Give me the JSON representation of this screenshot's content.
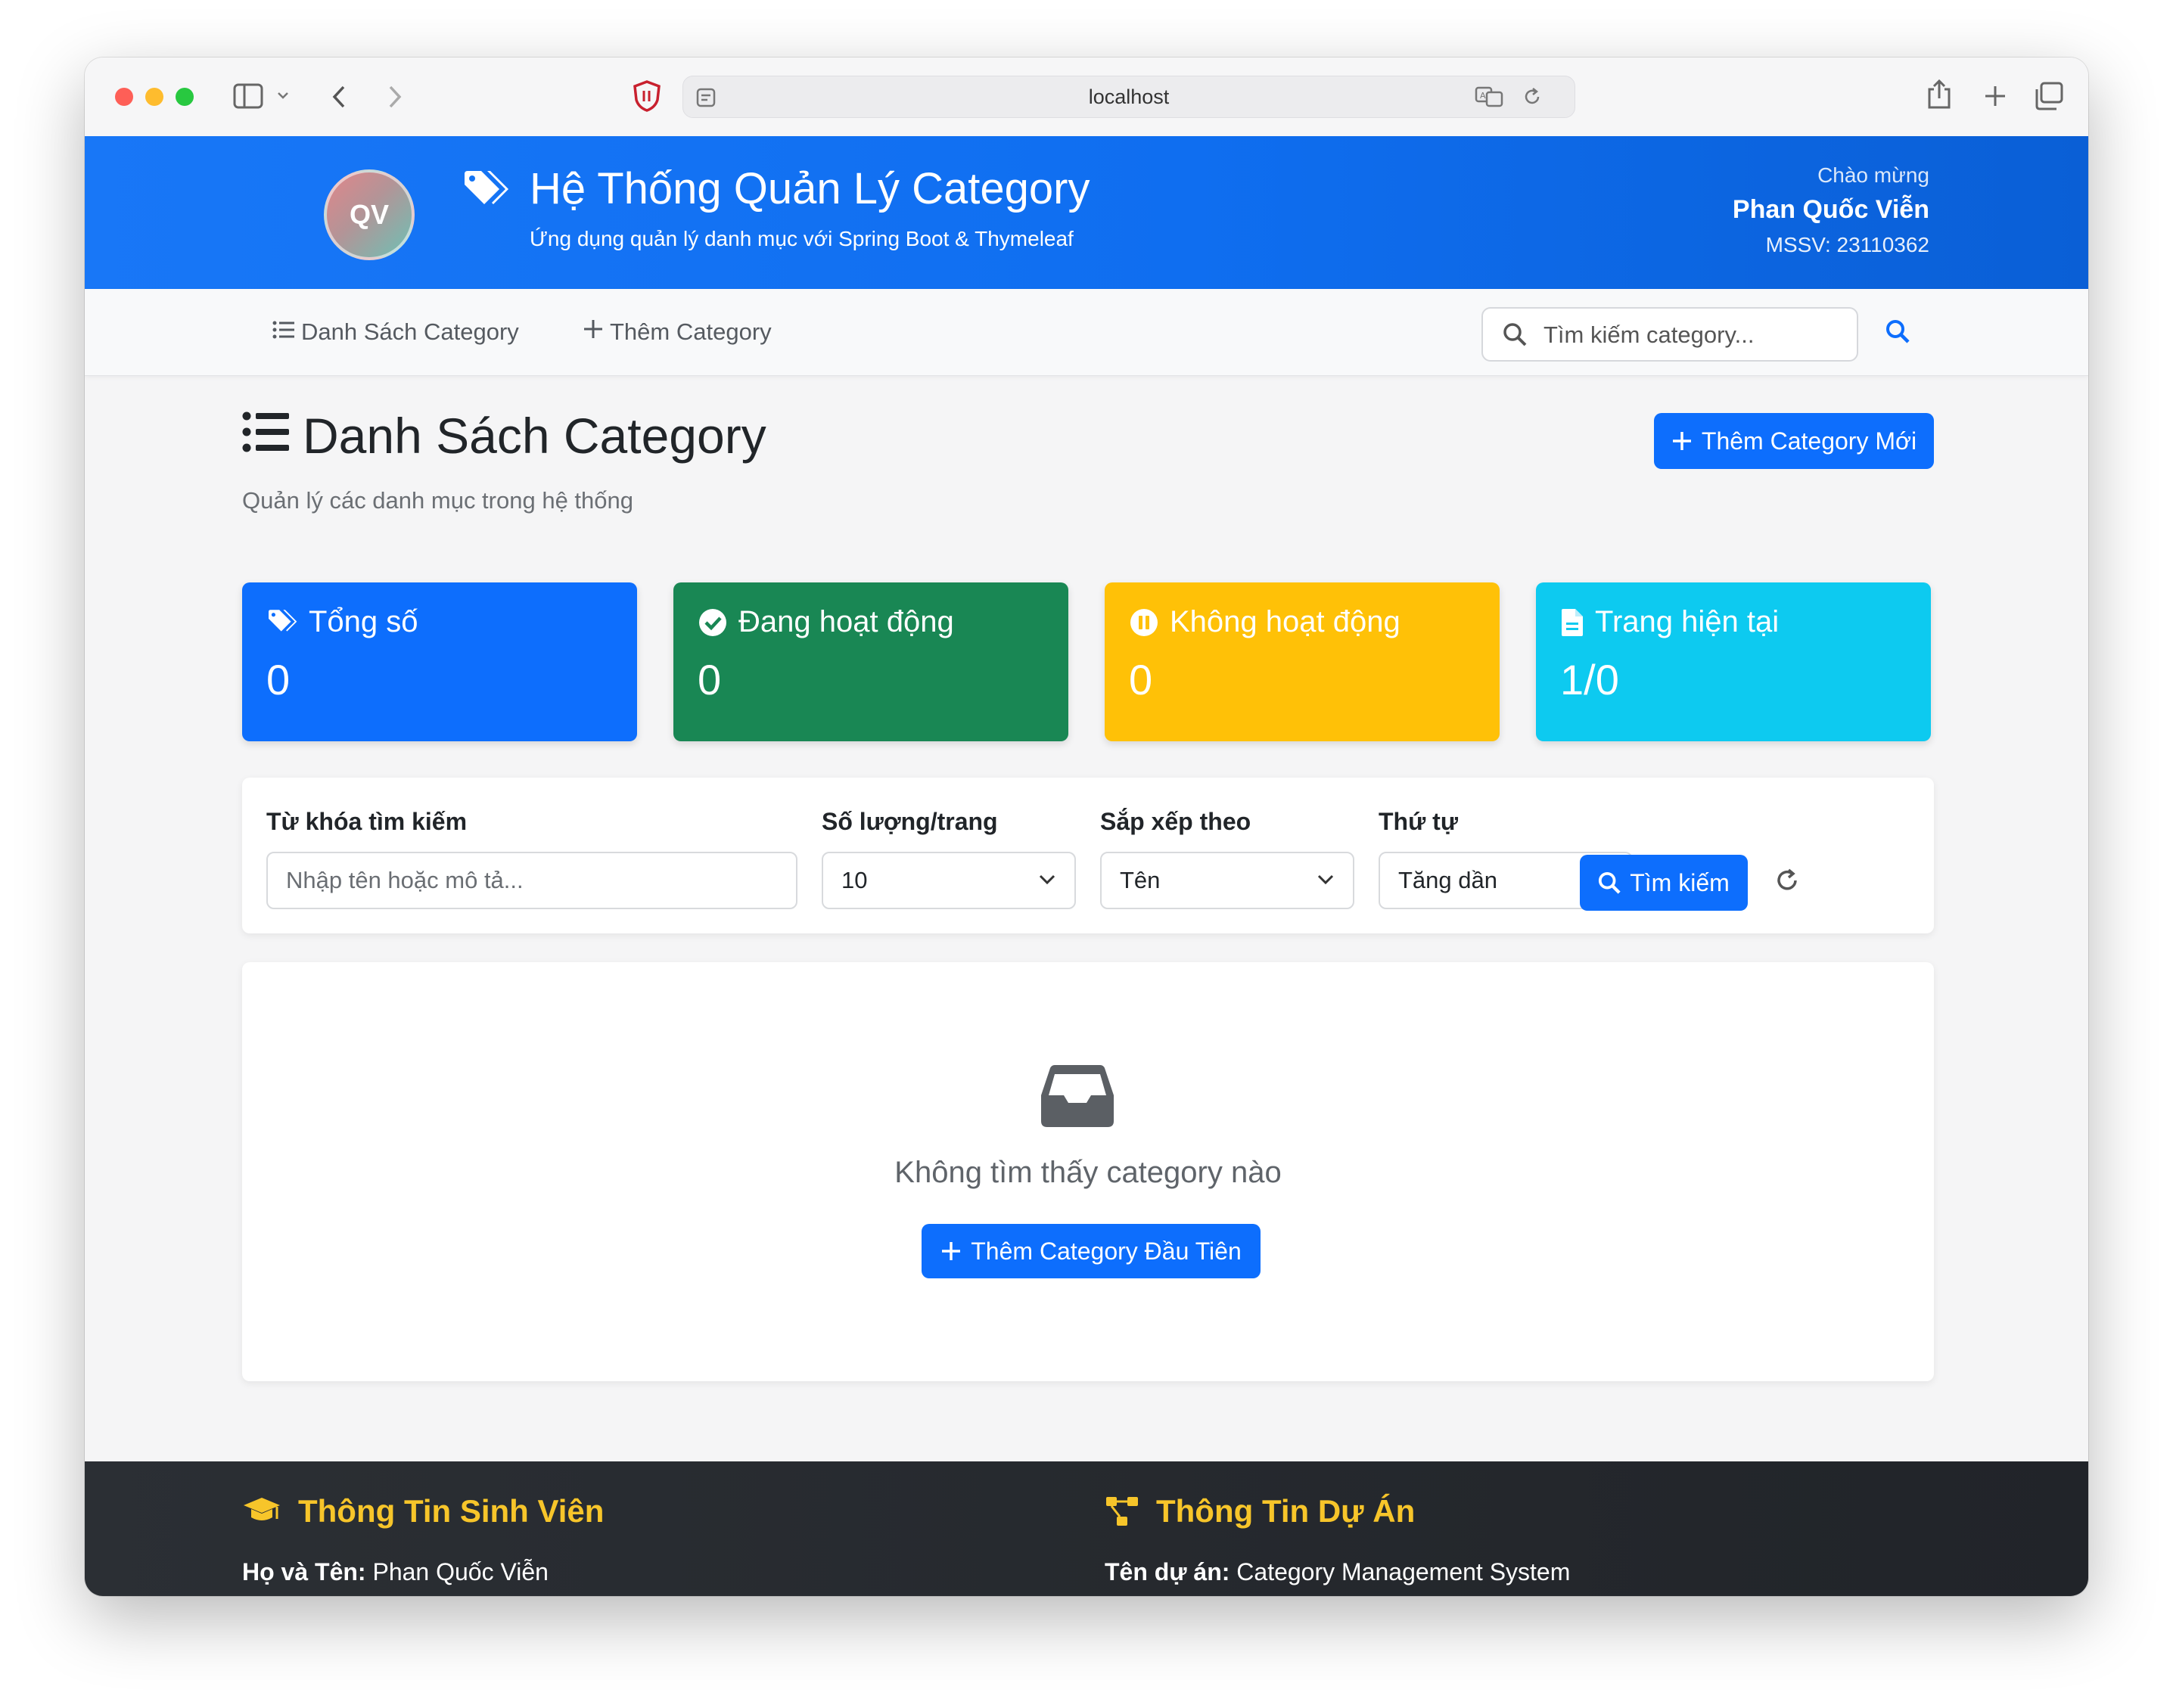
{
  "browser": {
    "url": "localhost"
  },
  "header": {
    "avatar_initials": "QV",
    "title": "Hệ Thống Quản Lý Category",
    "subtitle": "Ứng dụng quản lý danh mục với Spring Boot & Thymeleaf",
    "welcome": "Chào mừng",
    "user_name": "Phan Quốc Viễn",
    "mssv": "MSSV: 23110362"
  },
  "nav": {
    "list_label": "Danh Sách Category",
    "add_label": "Thêm Category",
    "search_placeholder": "Tìm kiếm category..."
  },
  "main": {
    "title": "Danh Sách Category",
    "subtitle": "Quản lý các danh mục trong hệ thống",
    "add_button": "Thêm Category Mới"
  },
  "stats": [
    {
      "label": "Tổng số",
      "value": "0",
      "color": "#0d6efd",
      "icon": "tags-icon"
    },
    {
      "label": "Đang hoạt động",
      "value": "0",
      "color": "#198754",
      "icon": "check-circle-icon"
    },
    {
      "label": "Không hoạt động",
      "value": "0",
      "color": "#ffc107",
      "icon": "pause-circle-icon"
    },
    {
      "label": "Trang hiện tại",
      "value": "1/0",
      "color": "#0dcaf0",
      "icon": "file-icon"
    }
  ],
  "filter": {
    "keyword_label": "Từ khóa tìm kiếm",
    "keyword_placeholder": "Nhập tên hoặc mô tả...",
    "page_size_label": "Số lượng/trang",
    "page_size_value": "10",
    "sort_by_label": "Sắp xếp theo",
    "sort_by_value": "Tên",
    "order_label": "Thứ tự",
    "order_value": "Tăng dần",
    "search_button": "Tìm kiếm"
  },
  "empty": {
    "message": "Không tìm thấy category nào",
    "button": "Thêm Category Đầu Tiên"
  },
  "footer": {
    "student_heading": "Thông Tin Sinh Viên",
    "student_name_label": "Họ và Tên:",
    "student_name": "Phan Quốc Viễn",
    "project_heading": "Thông Tin Dự Án",
    "project_name_label": "Tên dự án:",
    "project_name": "Category Management System"
  },
  "colors": {
    "primary": "#0d6efd",
    "success": "#198754",
    "warning": "#ffc107",
    "info": "#0dcaf0",
    "footer_heading": "#f7c52a"
  }
}
